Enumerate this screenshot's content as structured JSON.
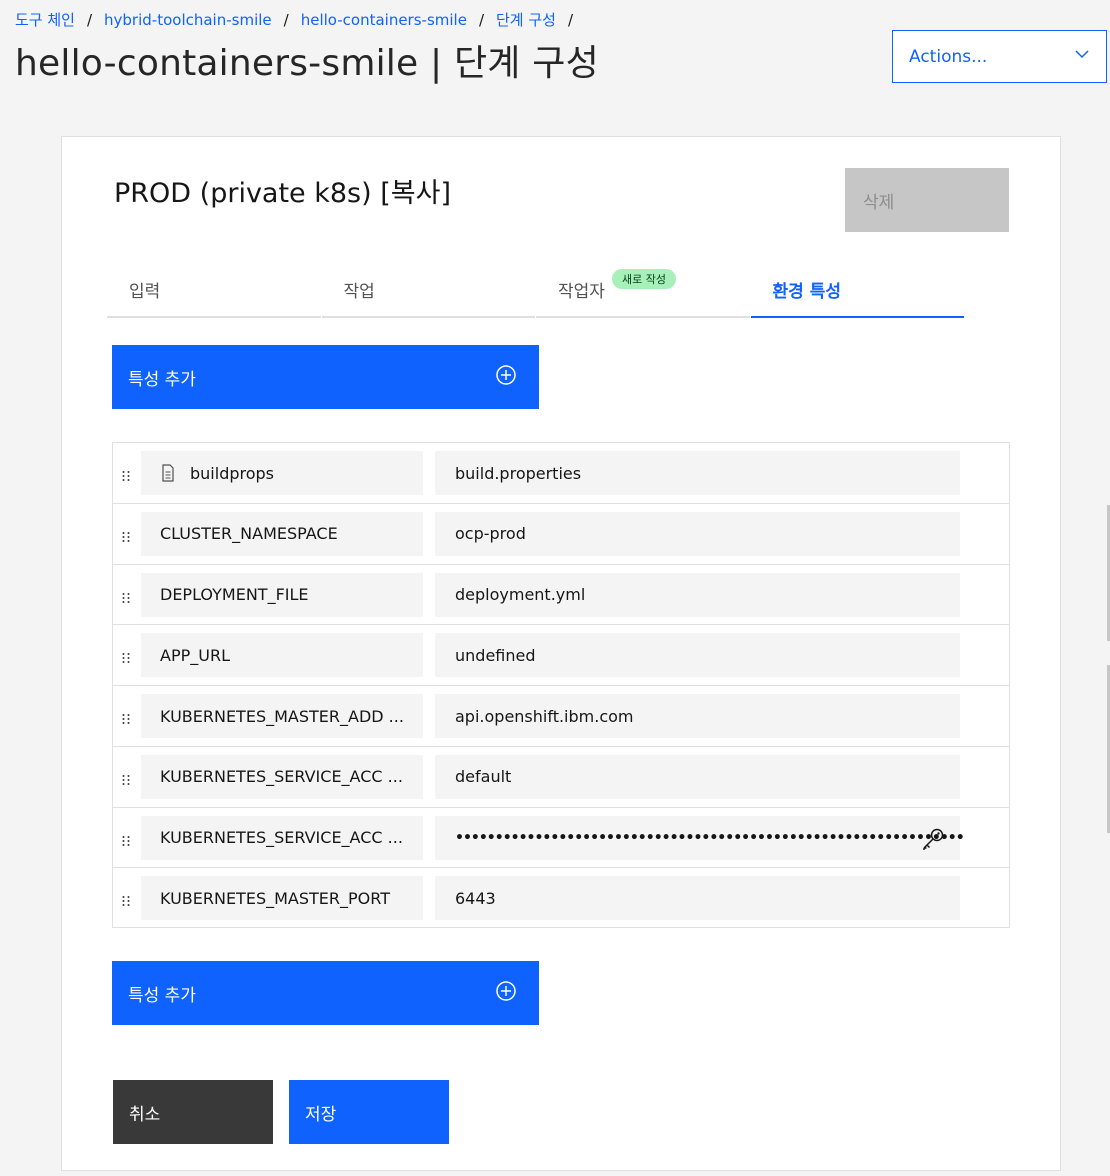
{
  "breadcrumb": [
    "도구 체인",
    "hybrid-toolchain-smile",
    "hello-containers-smile",
    "단계 구성"
  ],
  "page_title": "hello-containers-smile | 단계 구성",
  "actions_label": "Actions...",
  "stage": {
    "title": "PROD (private k8s) [복사]",
    "delete_label": "삭제"
  },
  "tabs": [
    {
      "label": "입력"
    },
    {
      "label": "작업"
    },
    {
      "label": "작업자",
      "badge": "새로 작성"
    },
    {
      "label": "환경 특성",
      "active": true
    }
  ],
  "add_property_label": "특성 추가",
  "properties": [
    {
      "name": "buildprops",
      "value": "build.properties",
      "icon": "file-icon"
    },
    {
      "name": "CLUSTER_NAMESPACE",
      "value": "ocp-prod"
    },
    {
      "name": "DEPLOYMENT_FILE",
      "value": "deployment.yml"
    },
    {
      "name": "APP_URL",
      "value": "undefined"
    },
    {
      "name": "KUBERNETES_MASTER_ADD ...",
      "value": "api.openshift.ibm.com"
    },
    {
      "name": "KUBERNETES_SERVICE_ACC ...",
      "value": "default"
    },
    {
      "name": "KUBERNETES_SERVICE_ACC ...",
      "value": "••••••••••••••••••••••••••••••••••••••••••••••••••••••••••••••••",
      "icon": "key-icon"
    },
    {
      "name": "KUBERNETES_MASTER_PORT",
      "value": "6443"
    }
  ],
  "cancel_label": "취소",
  "save_label": "저장",
  "colors": {
    "primary": "#0f62fe",
    "secondary": "#393939",
    "disabled": "#c6c6c6",
    "badge": "#a7f0ba"
  }
}
